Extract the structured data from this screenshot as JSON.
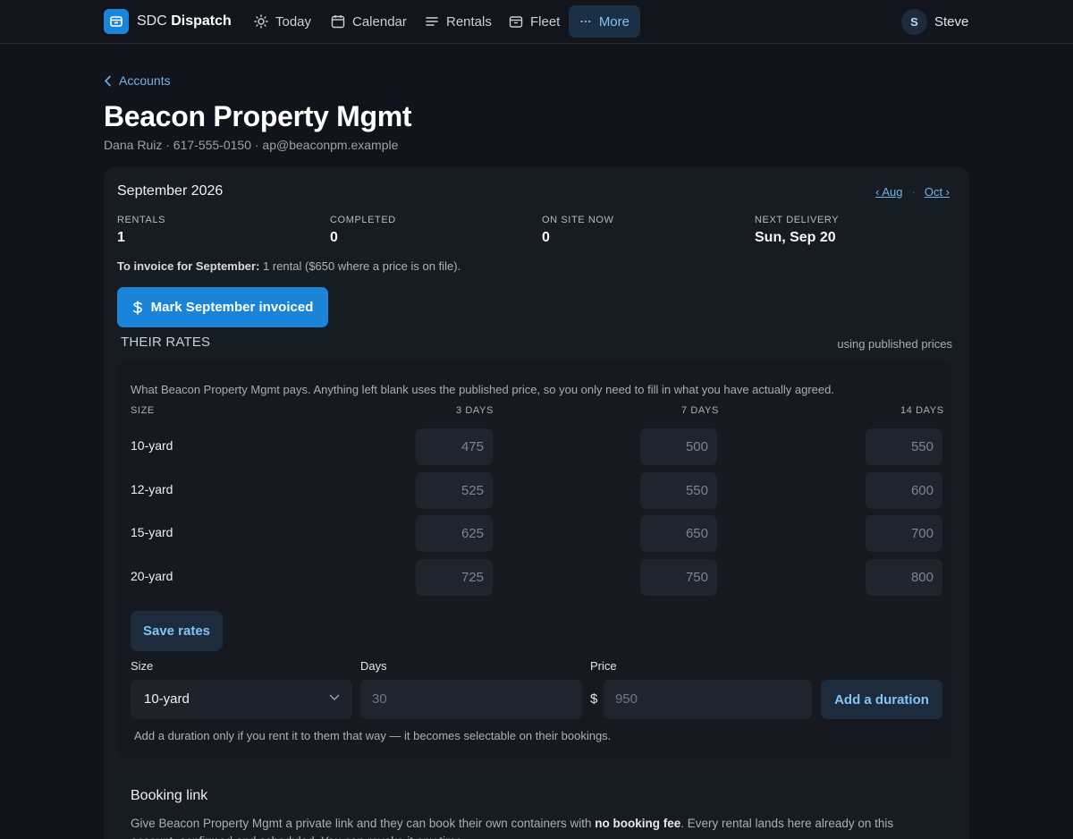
{
  "nav": {
    "brand_light": "SDC",
    "brand_bold": "Dispatch",
    "items": [
      {
        "label": "Today",
        "icon": "sun-icon"
      },
      {
        "label": "Calendar",
        "icon": "calendar-icon"
      },
      {
        "label": "Rentals",
        "icon": "list-icon"
      },
      {
        "label": "Fleet",
        "icon": "container-icon"
      },
      {
        "label": "More",
        "icon": "more-dots-icon",
        "active": true
      }
    ],
    "user": {
      "initial": "S",
      "name": "Steve"
    }
  },
  "header": {
    "back_label": "Accounts",
    "title": "Beacon Property Mgmt",
    "subtitle": "Dana Ruiz · 617-555-0150 · ap@beaconpm.example"
  },
  "month": {
    "label": "September 2026",
    "prev": "‹ Aug",
    "next": "Oct ›"
  },
  "stats": [
    {
      "label": "RENTALS",
      "value": "1"
    },
    {
      "label": "COMPLETED",
      "value": "0"
    },
    {
      "label": "ON SITE NOW",
      "value": "0"
    },
    {
      "label": "NEXT DELIVERY",
      "value": "Sun, Sep 20"
    }
  ],
  "invoice": {
    "note_bold": "To invoice for September:",
    "note_rest": " 1 rental ($650 where a price is on file).",
    "button": "Mark September invoiced"
  },
  "rates": {
    "title": "THEIR RATES",
    "status": "using published prices",
    "description": "What Beacon Property Mgmt pays. Anything left blank uses the published price, so you only need to fill in what you have actually agreed.",
    "columns": [
      "SIZE",
      "3 DAYS",
      "7 DAYS",
      "14 DAYS"
    ],
    "rows": [
      {
        "size": "10-yard",
        "prices": [
          "475",
          "500",
          "550"
        ]
      },
      {
        "size": "12-yard",
        "prices": [
          "525",
          "550",
          "600"
        ]
      },
      {
        "size": "15-yard",
        "prices": [
          "625",
          "650",
          "700"
        ]
      },
      {
        "size": "20-yard",
        "prices": [
          "725",
          "750",
          "800"
        ]
      }
    ],
    "save_button": "Save rates"
  },
  "duration": {
    "size_label": "Size",
    "size_value": "10-yard",
    "days_label": "Days",
    "days_placeholder": "30",
    "price_label": "Price",
    "currency": "$",
    "price_placeholder": "950",
    "add_button": "Add a duration",
    "note": "Add a duration only if you rent it to them that way — it becomes selectable on their bookings."
  },
  "booking": {
    "title": "Booking link",
    "text_start": "Give Beacon Property Mgmt a private link and they can book their own containers with ",
    "text_bold": "no booking fee",
    "text_end": ". Every rental lands here already on this account, confirmed and scheduled. You can revoke it any time."
  }
}
